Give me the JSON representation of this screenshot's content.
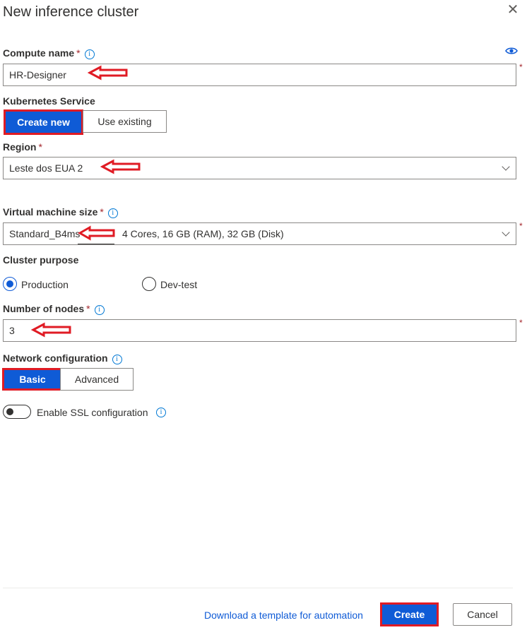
{
  "panel": {
    "title": "New inference cluster"
  },
  "compute_name": {
    "label": "Compute name",
    "required": "*",
    "value": "HR-Designer",
    "field_asterisk": "*"
  },
  "kubernetes": {
    "label": "Kubernetes Service",
    "options": [
      "Create new",
      "Use existing"
    ],
    "selected": "Create new"
  },
  "region": {
    "label": "Region",
    "required": "*",
    "value": "Leste dos EUA 2"
  },
  "vm_size": {
    "label": "Virtual machine size",
    "required": "*",
    "value": "Standard_B4ms",
    "detail": "4 Cores, 16 GB (RAM), 32 GB (Disk)",
    "field_asterisk": "*"
  },
  "cluster_purpose": {
    "label": "Cluster purpose",
    "options": [
      "Production",
      "Dev-test"
    ],
    "selected": "Production"
  },
  "nodes": {
    "label": "Number of nodes",
    "required": "*",
    "value": "3",
    "field_asterisk": "*"
  },
  "network": {
    "label": "Network configuration",
    "options": [
      "Basic",
      "Advanced"
    ],
    "selected": "Basic"
  },
  "ssl": {
    "label": "Enable SSL configuration",
    "enabled": false
  },
  "footer": {
    "template_link": "Download a template for automation",
    "create_label": "Create",
    "cancel_label": "Cancel"
  },
  "icons": {
    "close": "close-icon",
    "info": "info-icon",
    "eye": "eye-icon",
    "chevron": "chevron-down-icon",
    "annotation": "red-arrow-annotation"
  },
  "colors": {
    "accent": "#0f5bd6",
    "annotation": "#e01b24",
    "required": "#a4262c"
  }
}
